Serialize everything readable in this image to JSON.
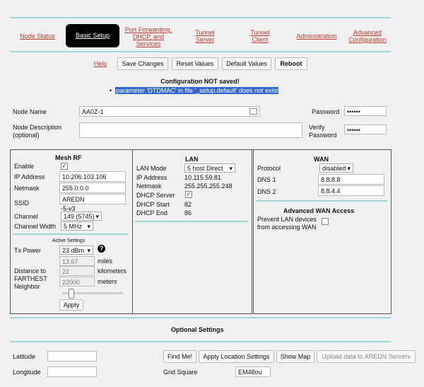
{
  "nav": {
    "items": [
      {
        "label": "Node Status"
      },
      {
        "label": "Basic Setup"
      },
      {
        "label": "Port Forwarding, DHCP, and Services"
      },
      {
        "label": "Tunnel Server"
      },
      {
        "label": "Tunnel Client"
      },
      {
        "label": "Administration"
      },
      {
        "label": "Advanced Configuration"
      }
    ]
  },
  "toolbar": {
    "help": "Help",
    "save": "Save Changes",
    "reset": "Reset Values",
    "default": "Default Values",
    "reboot": "Reboot"
  },
  "status": {
    "title": "Configuration NOT saved!",
    "message": "parameter 'DTDMAC' in file '_setup.default' does not exist"
  },
  "node": {
    "name_label": "Node Name",
    "name_value": "AA0Z-1",
    "desc_label": "Node Description (optional)",
    "desc_value": "",
    "password_label": "Password",
    "password_value": "••••••",
    "verify_label": "Verify Password",
    "verify_value": "••••••"
  },
  "mesh": {
    "title": "Mesh RF",
    "enable_label": "Enable",
    "enable_checked": true,
    "ip_label": "IP Address",
    "ip_value": "10.206.103.106",
    "netmask_label": "Netmask",
    "netmask_value": "255.0.0.0",
    "ssid_label": "SSID",
    "ssid_value": "AREDN",
    "ssid_suffix": "-5-v3",
    "channel_label": "Channel",
    "channel_value": "149 (5745)",
    "width_label": "Channel Width",
    "width_value": "5 MHz",
    "active_title": "Active Settings",
    "txpower_label": "Tx Power",
    "txpower_value": "23 dBm",
    "distance_label": "Distance to FARTHEST Neighbor",
    "miles_value": "13.67",
    "miles_unit": "miles",
    "km_value": "22",
    "km_unit": "kilometers",
    "meters_value": "22000",
    "meters_unit": "meters",
    "apply": "Apply"
  },
  "lan": {
    "title": "LAN",
    "mode_label": "LAN Mode",
    "mode_value": "5 host Direct",
    "ip_label": "IP Address",
    "ip_value": "10.115.59.81",
    "netmask_label": "Netmask",
    "netmask_value": "255.255.255.248",
    "dhcp_label": "DHCP Server",
    "dhcp_checked": true,
    "start_label": "DHCP Start",
    "start_value": "82",
    "end_label": "DHCP End",
    "end_value": "86"
  },
  "wan": {
    "title": "WAN",
    "protocol_label": "Protocol",
    "protocol_value": "disabled",
    "dns1_label": "DNS 1",
    "dns1_value": "8.8.8.8",
    "dns2_label": "DNS 2",
    "dns2_value": "8.8.4.4",
    "advanced_title": "Advanced WAN Access",
    "prevent_label": "Prevent LAN devices from accessing WAN"
  },
  "optional": {
    "title": "Optional Settings",
    "latitude_label": "Latitude",
    "latitude_value": "",
    "longitude_label": "Longitude",
    "longitude_value": "",
    "findme": "Find Me!",
    "apply_location": "Apply Location Settings",
    "show_map": "Show Map",
    "upload": "Upload data to AREDN Servers",
    "grid_label": "Grid Square",
    "grid_value": "EM48ou"
  },
  "colors": {
    "accent_line": "#9fd6d8",
    "link": "#c0392b",
    "highlight": "#3366cc"
  }
}
